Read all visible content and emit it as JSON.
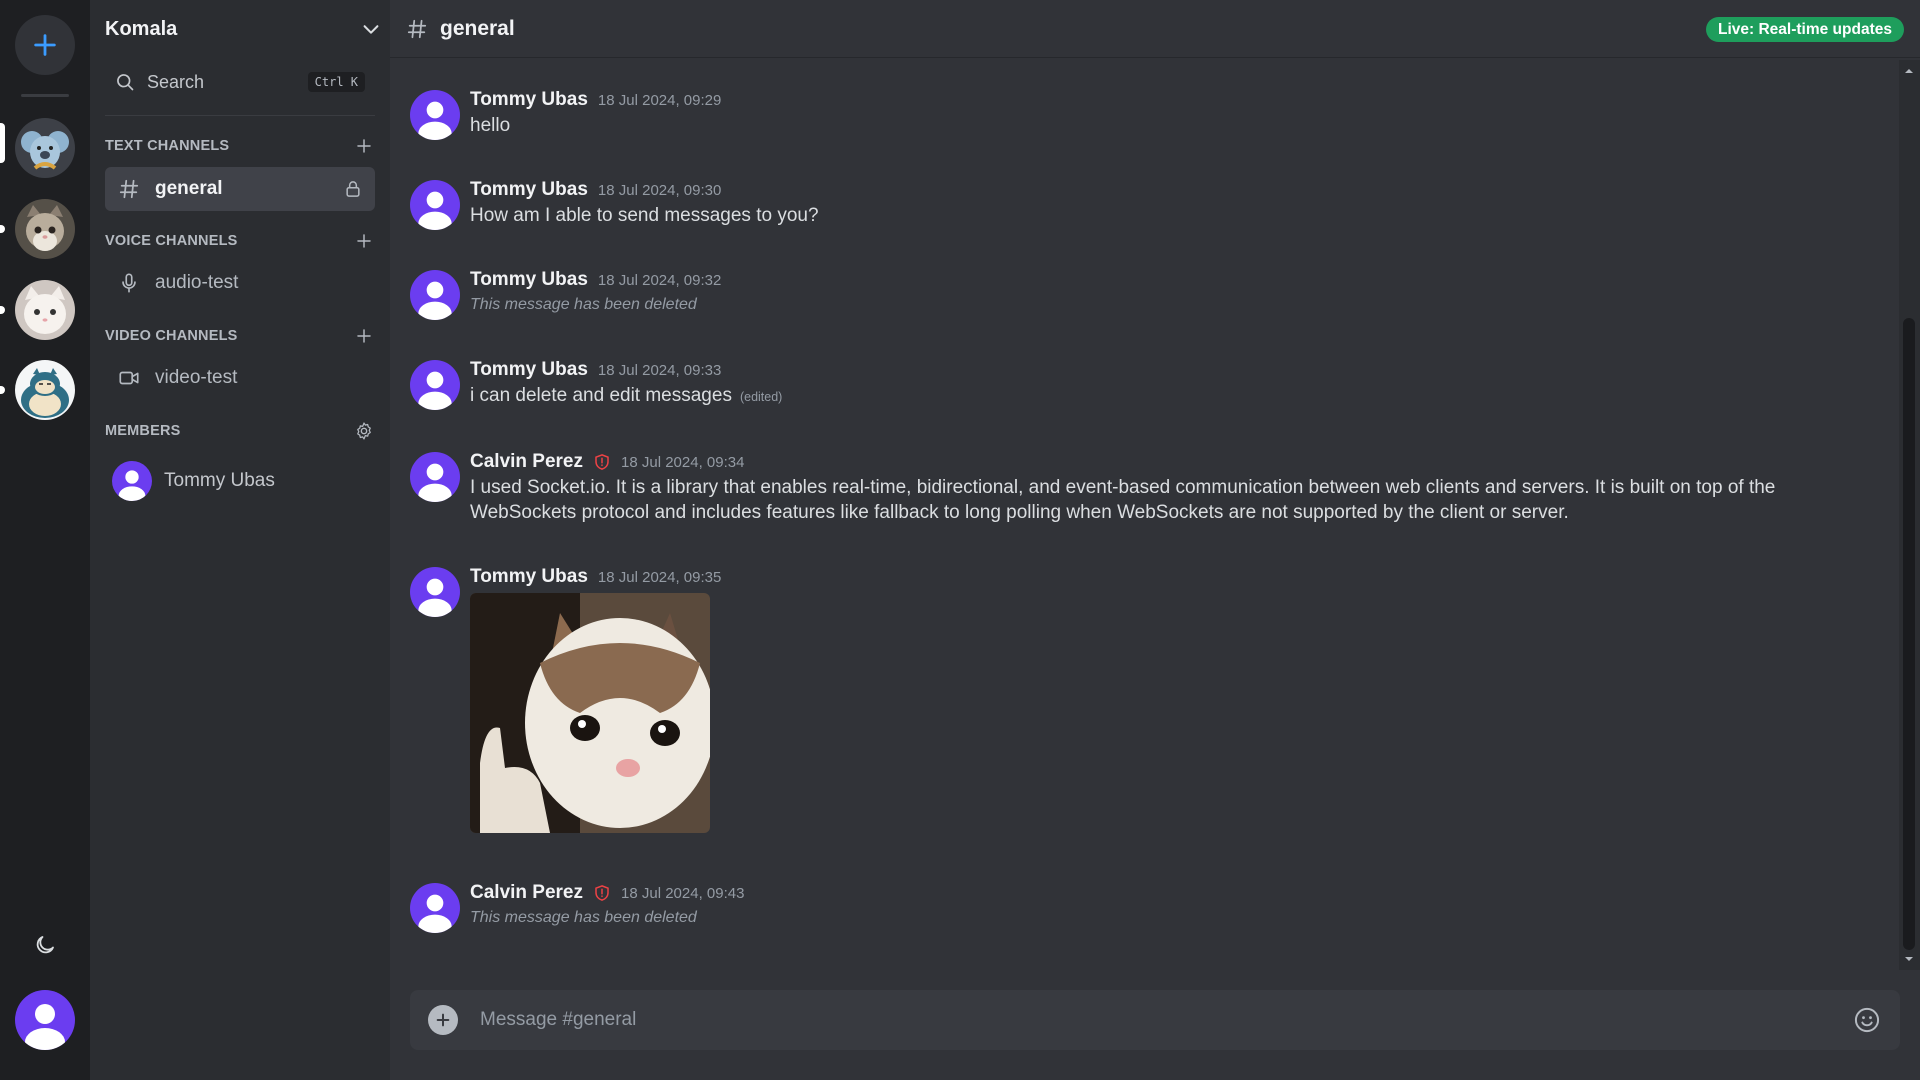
{
  "server": {
    "name": "Komala",
    "icons": [
      "koala-server-icon",
      "cat-server-icon",
      "white-cat-server-icon",
      "snorlax-server-icon"
    ]
  },
  "search": {
    "label": "Search",
    "shortcut": "Ctrl K"
  },
  "sections": {
    "text": "TEXT CHANNELS",
    "voice": "VOICE CHANNELS",
    "video": "VIDEO CHANNELS",
    "members": "MEMBERS"
  },
  "channels": {
    "text": [
      {
        "label": "general",
        "locked": true,
        "active": true
      }
    ],
    "voice": [
      {
        "label": "audio-test"
      }
    ],
    "video": [
      {
        "label": "video-test"
      }
    ]
  },
  "members": [
    {
      "name": "Tommy Ubas"
    }
  ],
  "header": {
    "channel": "general",
    "live_badge": "Live: Real-time updates"
  },
  "messages": [
    {
      "author": "Tommy Ubas",
      "time": "18 Jul 2024, 09:29",
      "text": "hello"
    },
    {
      "author": "Tommy Ubas",
      "time": "18 Jul 2024, 09:30",
      "text": "How am I able to send messages to you?"
    },
    {
      "author": "Tommy Ubas",
      "time": "18 Jul 2024, 09:32",
      "deleted": "This message has been deleted"
    },
    {
      "author": "Tommy Ubas",
      "time": "18 Jul 2024, 09:33",
      "text": "i can delete and edit messages",
      "edited": "(edited)"
    },
    {
      "author": "Calvin Perez",
      "moderator": true,
      "time": "18 Jul 2024, 09:34",
      "text": "I used Socket.io. It is a library that enables real-time, bidirectional, and event-based communication between web clients and servers. It is built on top of the WebSockets protocol and includes features like fallback to long polling when WebSockets are not supported by the client or server."
    },
    {
      "author": "Tommy Ubas",
      "time": "18 Jul 2024, 09:35",
      "image": "cat-thumbs-up-image"
    },
    {
      "author": "Calvin Perez",
      "moderator": true,
      "time": "18 Jul 2024, 09:43",
      "deleted": "This message has been deleted"
    }
  ],
  "composer": {
    "placeholder": "Message #general"
  },
  "colors": {
    "accent_live": "#1e9e5c",
    "avatar_purple": "#6b3df0",
    "moderator_red": "#ed4245",
    "add_button_blue": "#3b9cff"
  }
}
